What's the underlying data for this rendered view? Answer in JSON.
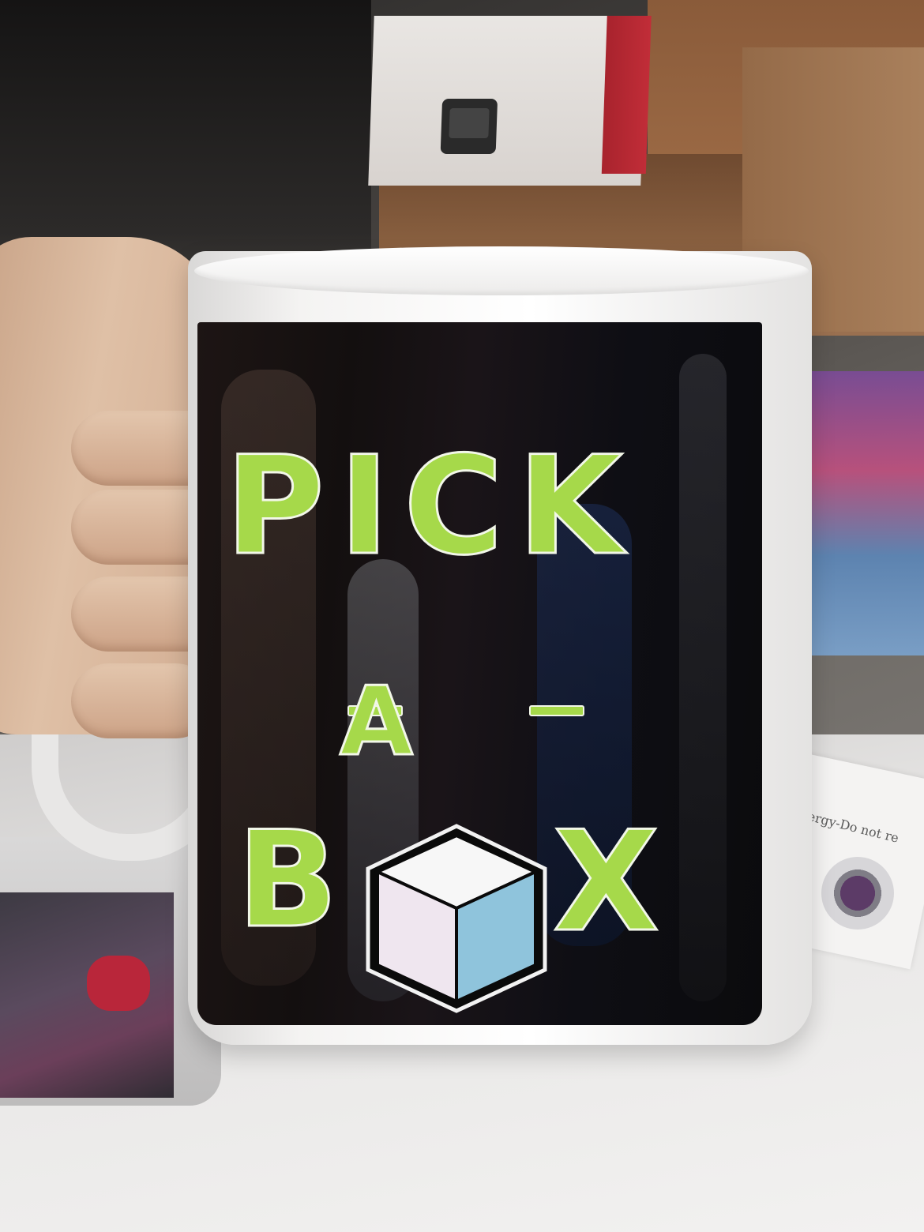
{
  "scene": {
    "mug_logo": {
      "line1": "PICK",
      "line2": "A",
      "line3_left": "B",
      "line3_right": "X"
    },
    "paper_text": "…ergy-Do not re",
    "colors": {
      "logo_green": "#a6d94a",
      "logo_outline": "#f2f7e8",
      "mug_print_black": "#130f0f",
      "cube_left_face": "#efe6ef",
      "cube_right_face": "#8fc4dc",
      "cube_top_face": "#f7f7f7",
      "mug_white": "#f4f3f2"
    },
    "icons": {
      "logo_box": "cube-icon"
    }
  }
}
